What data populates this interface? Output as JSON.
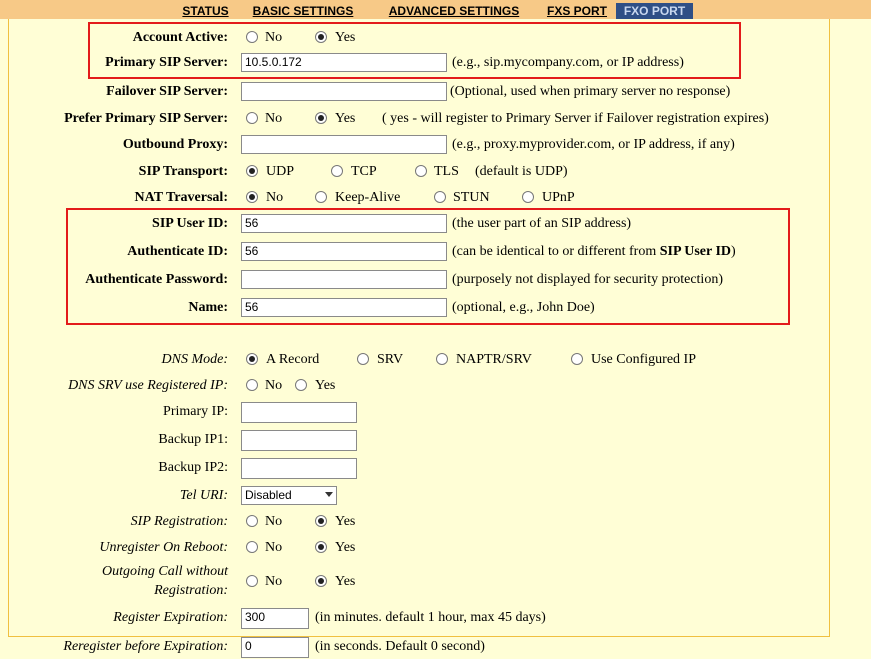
{
  "nav": {
    "tabs": [
      {
        "label": "STATUS"
      },
      {
        "label": "BASIC SETTINGS"
      },
      {
        "label": "ADVANCED SETTINGS"
      },
      {
        "label": "FXS PORT"
      },
      {
        "label": "FXO PORT"
      }
    ],
    "active_tab": "FXO PORT"
  },
  "form": {
    "account_active": {
      "label": "Account Active:",
      "options": [
        "No",
        "Yes"
      ],
      "selected": "Yes"
    },
    "primary_sip_server": {
      "label": "Primary SIP Server:",
      "value": "10.5.0.172",
      "hint": "(e.g., sip.mycompany.com, or IP address)"
    },
    "failover_sip_server": {
      "label": "Failover SIP Server:",
      "value": "",
      "hint": "(Optional, used when primary server no response)"
    },
    "prefer_primary": {
      "label": "Prefer Primary SIP Server:",
      "options": [
        "No",
        "Yes"
      ],
      "selected": "Yes",
      "hint": "( yes - will register to Primary Server if Failover registration expires)"
    },
    "outbound_proxy": {
      "label": "Outbound Proxy:",
      "value": "",
      "hint": "(e.g., proxy.myprovider.com, or IP address, if any)"
    },
    "sip_transport": {
      "label": "SIP Transport:",
      "options": [
        "UDP",
        "TCP",
        "TLS"
      ],
      "selected": "UDP",
      "hint": "(default is UDP)"
    },
    "nat_traversal": {
      "label": "NAT Traversal:",
      "options": [
        "No",
        "Keep-Alive",
        "STUN",
        "UPnP"
      ],
      "selected": "No"
    },
    "sip_user_id": {
      "label": "SIP User ID:",
      "value": "56",
      "hint": "(the user part of an SIP address)"
    },
    "authenticate_id": {
      "label": "Authenticate ID:",
      "value": "56",
      "hint_pre": "(can be identical to or different from ",
      "hint_bold": "SIP User ID",
      "hint_post": ")"
    },
    "authenticate_password": {
      "label": "Authenticate Password:",
      "value": "",
      "hint": "(purposely not displayed for security protection)"
    },
    "name": {
      "label": "Name:",
      "value": "56",
      "hint": "(optional, e.g., John Doe)"
    },
    "dns_mode": {
      "label": "DNS Mode:",
      "options": [
        "A Record",
        "SRV",
        "NAPTR/SRV",
        "Use Configured IP"
      ],
      "selected": "A Record"
    },
    "dns_srv_registered_ip": {
      "label": "DNS SRV use Registered IP:",
      "options": [
        "No",
        "Yes"
      ],
      "selected": "none"
    },
    "primary_ip": {
      "label": "Primary IP:",
      "value": ""
    },
    "backup_ip1": {
      "label": "Backup IP1:",
      "value": ""
    },
    "backup_ip2": {
      "label": "Backup IP2:",
      "value": ""
    },
    "tel_uri": {
      "label": "Tel URI:",
      "value": "Disabled"
    },
    "sip_registration": {
      "label": "SIP Registration:",
      "options": [
        "No",
        "Yes"
      ],
      "selected": "Yes"
    },
    "unregister_on_reboot": {
      "label": "Unregister On Reboot:",
      "options": [
        "No",
        "Yes"
      ],
      "selected": "Yes"
    },
    "outgoing_call_without_registration": {
      "label_line1": "Outgoing Call without",
      "label_line2": "Registration:",
      "options": [
        "No",
        "Yes"
      ],
      "selected": "Yes"
    },
    "register_expiration": {
      "label": "Register Expiration:",
      "value": "300",
      "hint": "(in minutes. default 1 hour, max 45 days)"
    },
    "reregister_before_expiration": {
      "label": "Reregister before Expiration:",
      "value": "0",
      "hint": "(in seconds. Default 0 second)"
    }
  },
  "colors": {
    "nav_bg": "#f7c987",
    "active_tab_bg": "#2f4f86",
    "page_bg": "#fffed6",
    "highlight_box": "#e31b1b",
    "panel_border": "#f0c040"
  }
}
